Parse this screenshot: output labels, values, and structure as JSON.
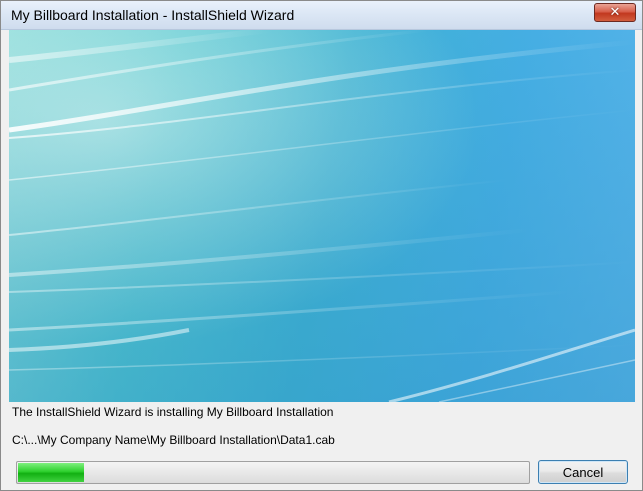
{
  "window": {
    "title": "My Billboard Installation - InstallShield Wizard",
    "close_icon": "close-icon"
  },
  "status": {
    "message": "The InstallShield Wizard is installing My Billboard Installation",
    "current_file": "C:\\...\\My Company Name\\My Billboard Installation\\Data1.cab"
  },
  "progress": {
    "fraction": 0.13,
    "color": "#1fc01f"
  },
  "buttons": {
    "cancel_label": "Cancel"
  }
}
